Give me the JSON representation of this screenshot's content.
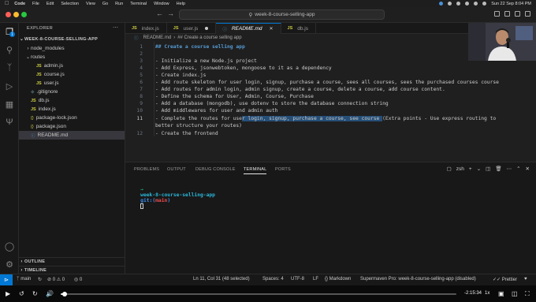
{
  "menubar": {
    "app": "Code",
    "items": [
      "File",
      "Edit",
      "Selection",
      "View",
      "Go",
      "Run",
      "Terminal",
      "Window",
      "Help"
    ],
    "clock": "Sun 22 Sep  8:04 PM"
  },
  "titlebar": {
    "search_text": "week-8-course-selling-app"
  },
  "explorer": {
    "header": "EXPLORER",
    "root": "WEEK-8-COURSE-SELLING-APP",
    "items": [
      {
        "name": "node_modules",
        "kind": "folder",
        "indent": 1,
        "expanded": false
      },
      {
        "name": "routes",
        "kind": "folder",
        "indent": 1,
        "expanded": true
      },
      {
        "name": "admin.js",
        "kind": "js",
        "indent": 2
      },
      {
        "name": "course.js",
        "kind": "js",
        "indent": 2
      },
      {
        "name": "user.js",
        "kind": "js",
        "indent": 2
      },
      {
        "name": ".gitignore",
        "kind": "git",
        "indent": 1
      },
      {
        "name": "db.js",
        "kind": "js",
        "indent": 1
      },
      {
        "name": "index.js",
        "kind": "js",
        "indent": 1
      },
      {
        "name": "package-lock.json",
        "kind": "json",
        "indent": 1
      },
      {
        "name": "package.json",
        "kind": "json",
        "indent": 1
      },
      {
        "name": "README.md",
        "kind": "md",
        "indent": 1,
        "selected": true
      }
    ],
    "outline": "OUTLINE",
    "timeline": "TIMELINE"
  },
  "tabs": [
    {
      "label": "index.js",
      "kind": "js",
      "active": false,
      "dirty": false
    },
    {
      "label": "user.js",
      "kind": "js",
      "active": false,
      "dirty": true
    },
    {
      "label": "README.md",
      "kind": "md",
      "active": true,
      "dirty": false
    },
    {
      "label": "db.js",
      "kind": "js",
      "active": false,
      "dirty": false
    }
  ],
  "breadcrumb": {
    "file": "README.md",
    "section": "## Create a course selling app"
  },
  "editor": {
    "lines": [
      {
        "n": "1",
        "text": "## Create a course selling app",
        "heading": true
      },
      {
        "n": "2",
        "text": ""
      },
      {
        "n": "3",
        "text": "- Initialize a new Node.js project"
      },
      {
        "n": "4",
        "text": "- Add Express, jsonwebtoken, mongoose to it as a dependency"
      },
      {
        "n": "5",
        "text": "- Create index.js"
      },
      {
        "n": "6",
        "text": "- Add route skeleton for user login, signup, purchase a course, sees all courses, sees the purchased courses course"
      },
      {
        "n": "7",
        "text": "- Add routes for admin login, admin signup, create a course, delete a course, add course content."
      },
      {
        "n": "8",
        "text": "- Define the schema for User, Admin, Course, Purchase"
      },
      {
        "n": "9",
        "text": "- Add a database (mongodb), use dotenv to store the database connection string"
      },
      {
        "n": "10",
        "text": "- Add middlewares for user and admin auth"
      },
      {
        "n": "11",
        "before": "- Complete the routes for use",
        "selected": "r login, signup, purchase a course, see course ",
        "after": "(Extra points - Use express routing to",
        "wrap": "better structure your routes)",
        "current": true
      },
      {
        "n": "12",
        "text": "- Create the frontend"
      }
    ]
  },
  "panel": {
    "tabs": [
      "PROBLEMS",
      "OUTPUT",
      "DEBUG CONSOLE",
      "TERMINAL",
      "PORTS"
    ],
    "active_tab": "TERMINAL",
    "shell": "zsh",
    "prompt_arrow": "→",
    "prompt_dir": "week-8-course-selling-app",
    "prompt_git": "git:(",
    "prompt_branch": "main",
    "prompt_git_close": ")"
  },
  "statusbar": {
    "branch": "main",
    "sync": "↻",
    "problems": "⊘ 0 ⚠ 0",
    "ports": "◎ 0",
    "position": "Ln 11, Col 31 (48 selected)",
    "spaces": "Spaces: 4",
    "encoding": "UTF-8",
    "eol": "LF",
    "language": "{} Markdown",
    "supermaven": "Supermaven Pro: week-8-course-selling-app (disabled)",
    "prettier": "✓✓ Prettier"
  },
  "player": {
    "time_remaining": "-2:15:34",
    "speed": "1x",
    "progress_fraction": 0.01,
    "colors": {
      "accent": "#0078d4",
      "selection": "#264f78",
      "terminal_green": "#23d18b",
      "terminal_cyan": "#29b8db",
      "terminal_red": "#f14c4c"
    }
  }
}
